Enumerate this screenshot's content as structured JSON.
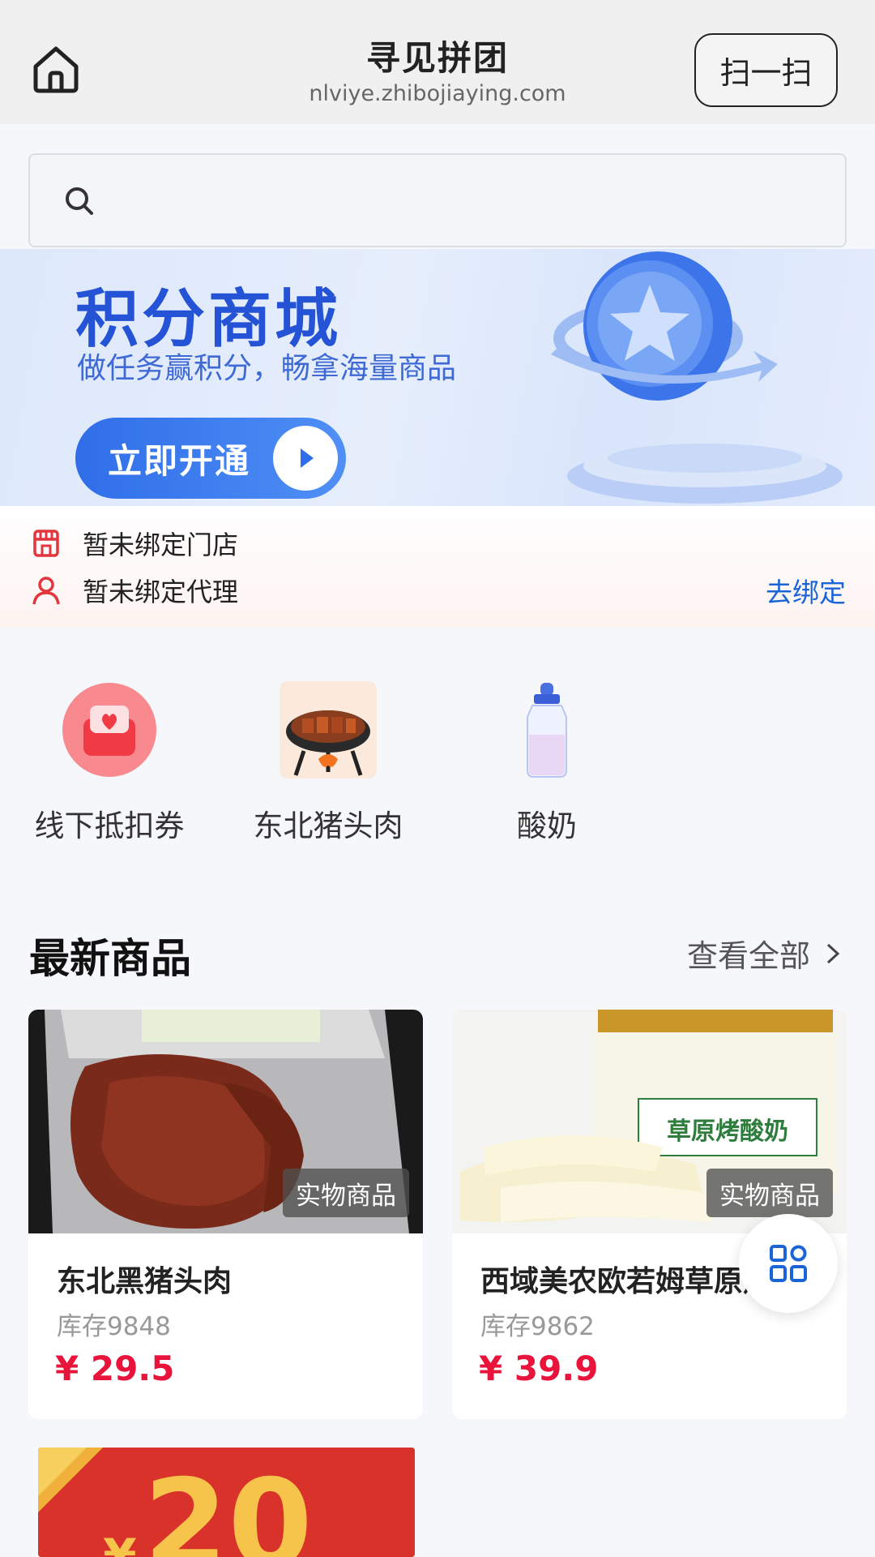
{
  "header": {
    "title": "寻见拼团",
    "url": "nlviye.zhibojiaying.com",
    "scan_label": "扫一扫"
  },
  "search": {
    "placeholder": ""
  },
  "banner": {
    "title": "积分商城",
    "subtitle": "做任务赢积分，畅拿海量商品",
    "button_label": "立即开通"
  },
  "binding": {
    "store_text": "暂未绑定门店",
    "agent_text": "暂未绑定代理",
    "link_label": "去绑定"
  },
  "categories": [
    {
      "label": "线下抵扣券",
      "icon": "coupon-icon"
    },
    {
      "label": "东北猪头肉",
      "icon": "grill-icon"
    },
    {
      "label": "酸奶",
      "icon": "milk-bottle-icon"
    }
  ],
  "section": {
    "title": "最新商品",
    "view_all": "查看全部"
  },
  "products": [
    {
      "tag": "实物商品",
      "name": "东北黑猪头肉",
      "stock": "库存9848",
      "price": "¥ 29.5"
    },
    {
      "tag": "实物商品",
      "name": "西域美农欧若姆草原烤酸奶",
      "stock": "库存9862",
      "price": "¥ 39.9"
    }
  ],
  "coupon_peek": {
    "yen": "¥",
    "amount": "20"
  },
  "product_images": {
    "yogurt_pack_label": "草原烤酸奶"
  },
  "colors": {
    "accent_blue": "#1a64d8",
    "price_red": "#e8143c",
    "banner_blue": "#2553d6"
  }
}
